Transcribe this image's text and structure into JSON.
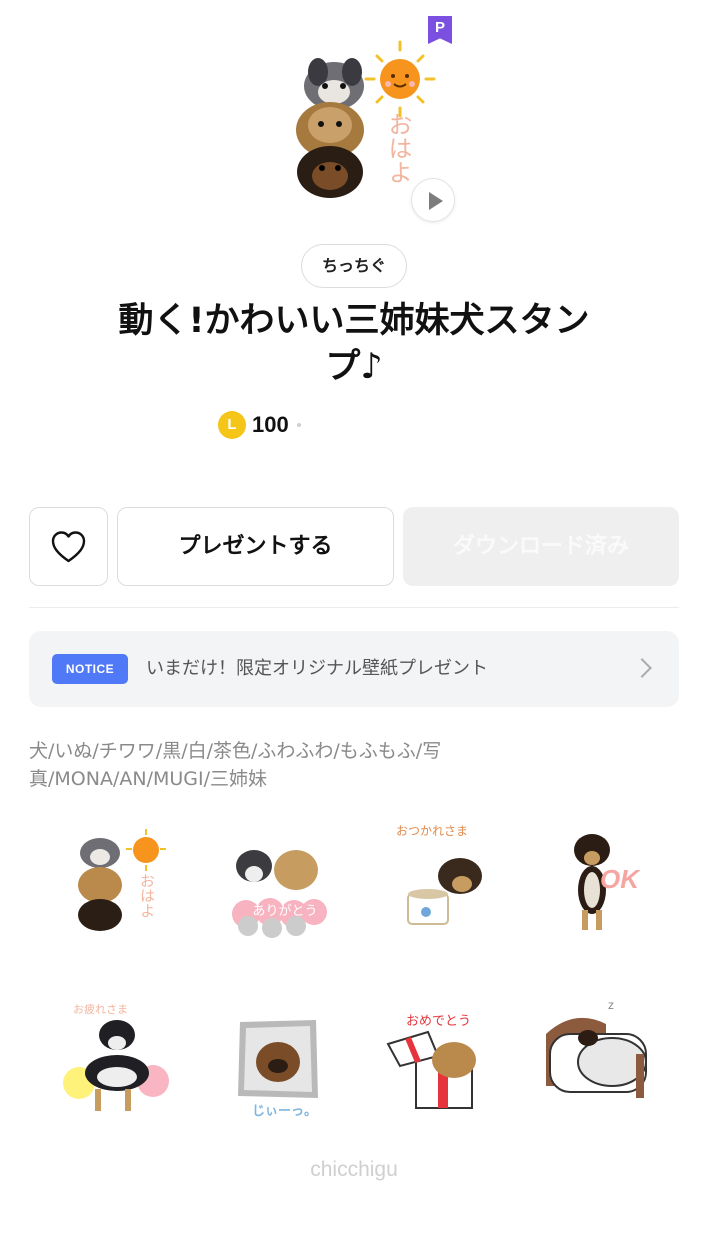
{
  "header": {
    "premium_badge": "P",
    "hero_caption": "おはよ",
    "play_icon": "play-icon"
  },
  "product": {
    "author": "ちっちぐ",
    "title_line1": "動く!かわいい三姉妹犬スタン",
    "title_line2": "プ♪",
    "coin_symbol": "L",
    "price": "100"
  },
  "actions": {
    "favorite_icon": "heart-icon",
    "present_label": "プレゼントする",
    "download_label": "ダウンロード済み"
  },
  "notice": {
    "badge": "NOTICE",
    "text": "いまだけ！限定オリジナル壁紙プレゼント",
    "chevron_icon": "chevron-right-icon"
  },
  "tags": {
    "line1": "犬/いぬ/チワワ/黒/白/茶色/ふわふわ/もふもふ/写",
    "line2": "真/MONA/AN/MUGI/三姉妹"
  },
  "stickers": {
    "s1_caption": "おはよ",
    "s2_caption": "ありがとう",
    "s3_caption": "おつかれさま",
    "s4_caption": "OK",
    "s5_caption": "お疲れさま",
    "s6_caption": "じぃーっ。",
    "s7_caption": "おめでとう",
    "s8_caption": "z"
  },
  "watermark": "chicchigu",
  "colors": {
    "accent_blue": "#4f79f7",
    "premium_purple": "#7b4fe0",
    "coin_gold": "#f5c518",
    "disabled_bg": "#efefef"
  }
}
